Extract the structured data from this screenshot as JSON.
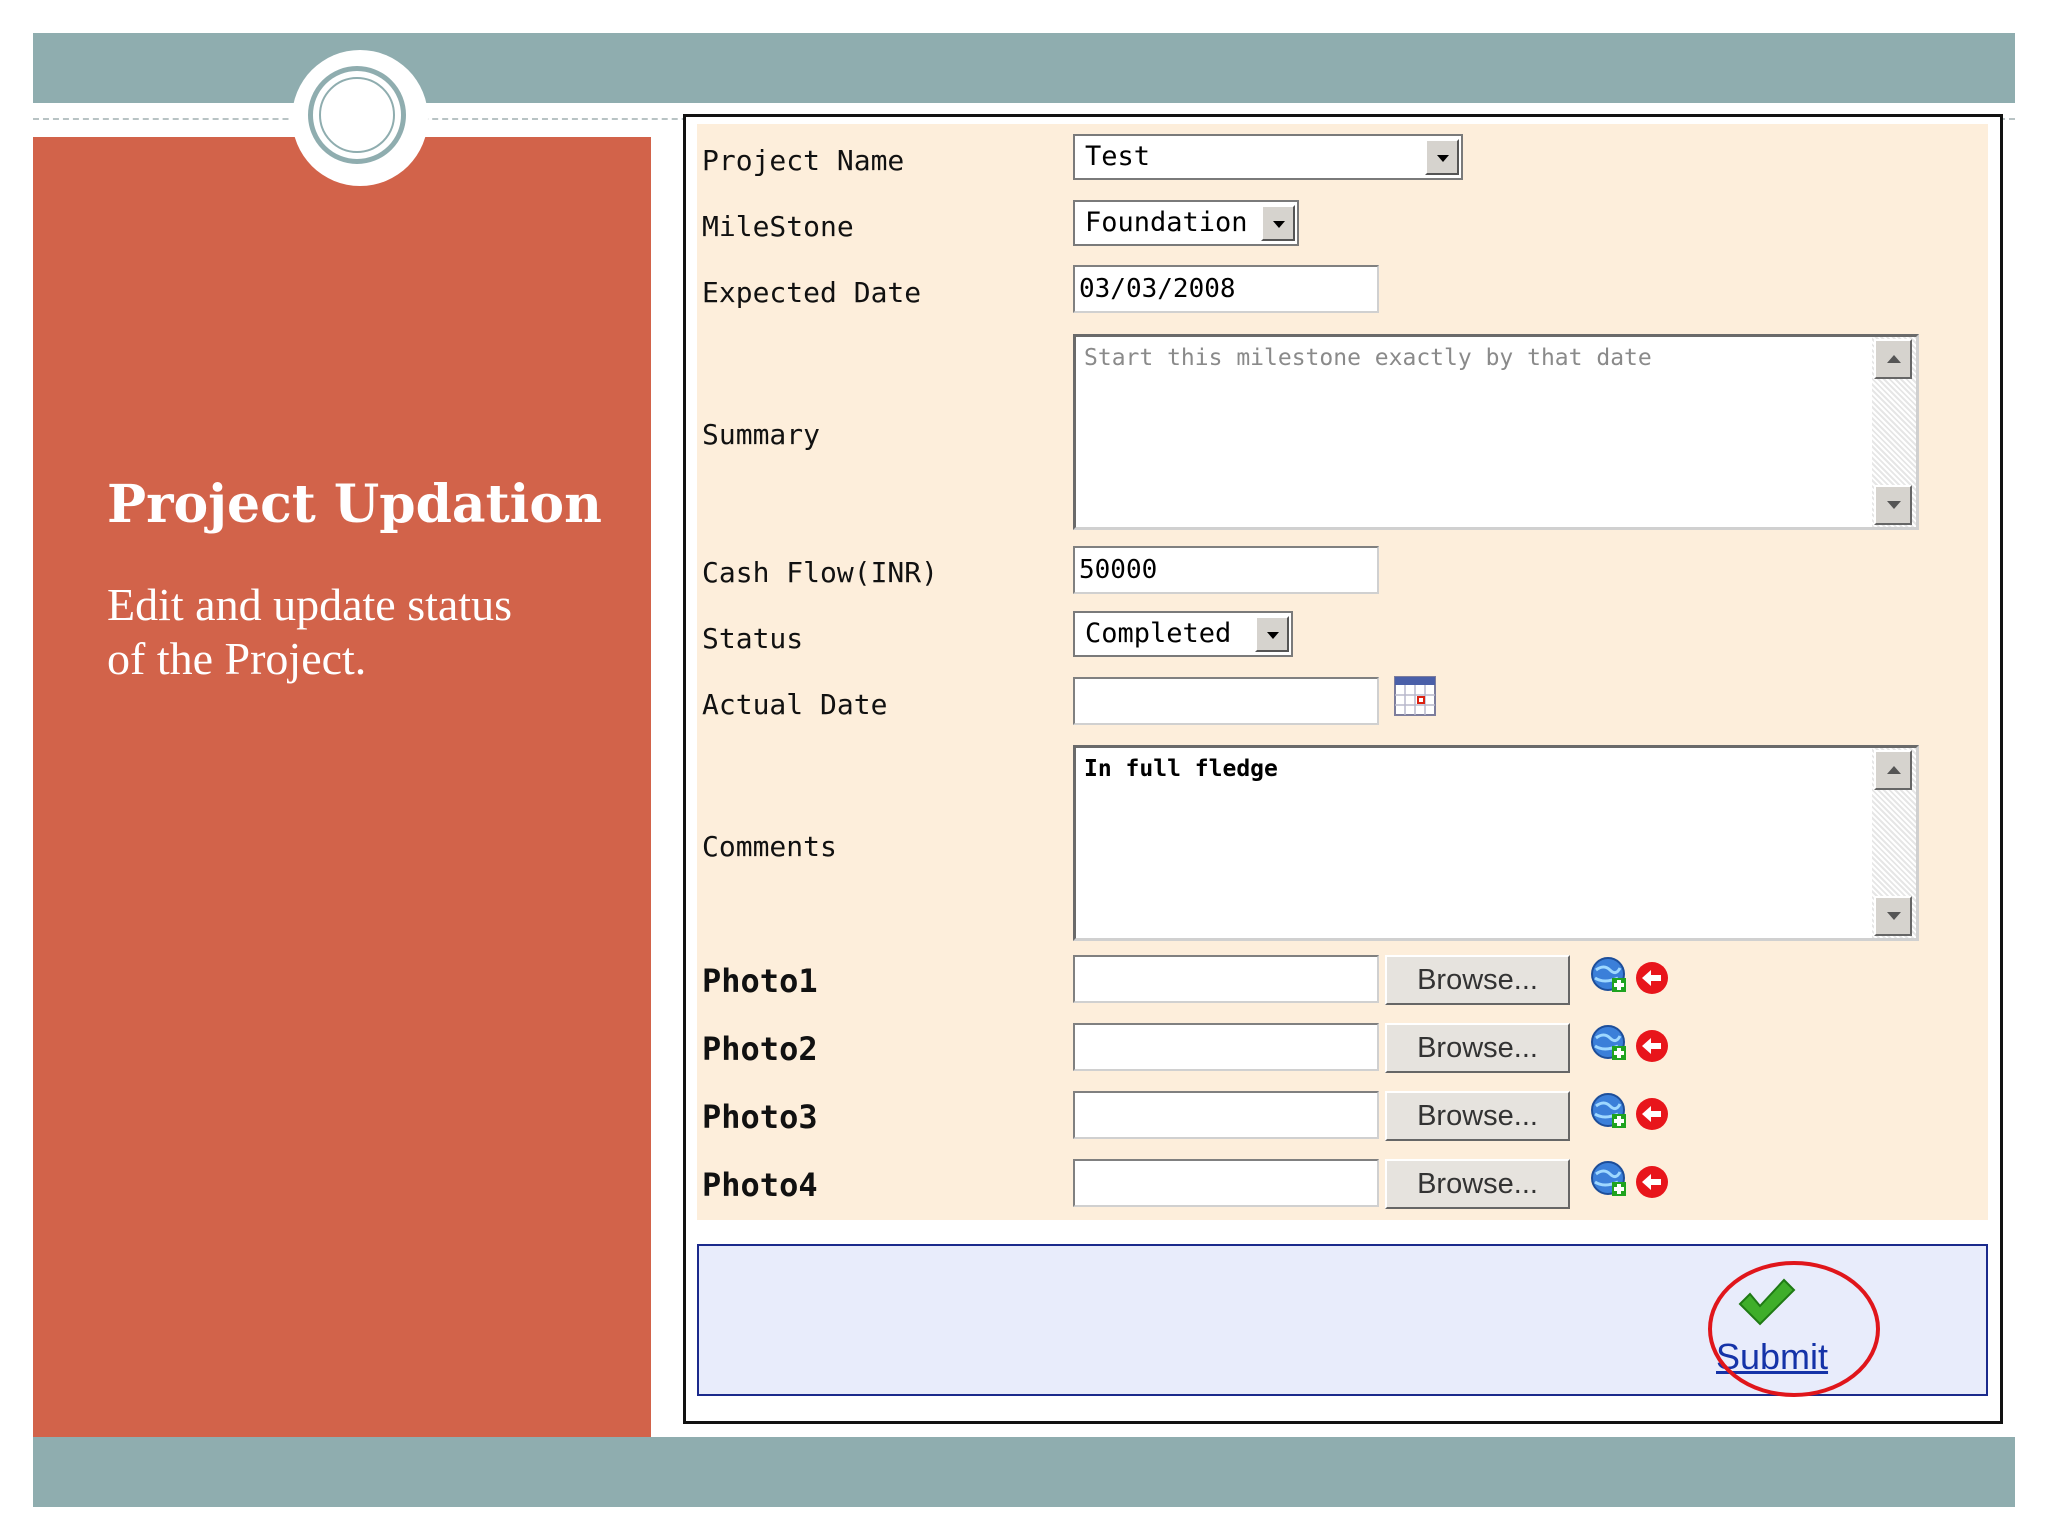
{
  "slide": {
    "title": "Project Updation",
    "subtitle_line1": "Edit and update status",
    "subtitle_line2": "of the Project."
  },
  "form": {
    "project_name": {
      "label": "Project Name",
      "value": "Test"
    },
    "milestone": {
      "label": "MileStone",
      "value": "Foundation"
    },
    "expected_date": {
      "label": "Expected Date",
      "value": "03/03/2008"
    },
    "summary": {
      "label": "Summary",
      "value": "Start this milestone exactly by that date"
    },
    "cash_flow": {
      "label": "Cash Flow(INR)",
      "value": "50000"
    },
    "status": {
      "label": "Status",
      "value": "Completed"
    },
    "actual_date": {
      "label": "Actual Date",
      "value": ""
    },
    "comments": {
      "label": "Comments",
      "value": "In full fledge"
    },
    "photos": [
      {
        "label": "Photo1",
        "value": "",
        "browse_label": "Browse..."
      },
      {
        "label": "Photo2",
        "value": "",
        "browse_label": "Browse..."
      },
      {
        "label": "Photo3",
        "value": "",
        "browse_label": "Browse..."
      },
      {
        "label": "Photo4",
        "value": "",
        "browse_label": "Browse..."
      }
    ]
  },
  "submit": {
    "label": "Submit"
  },
  "colors": {
    "left_panel": "#d2634a",
    "band": "#8fadaf",
    "form_bg": "#fdeedb",
    "submit_bar_bg": "#e8ecfb",
    "link": "#1533a8",
    "highlight_circle": "#e0161b"
  },
  "icons": {
    "calendar": "calendar-icon",
    "upload": "globe-add-icon",
    "remove": "remove-arrow-icon",
    "submit": "checkmark-icon"
  }
}
